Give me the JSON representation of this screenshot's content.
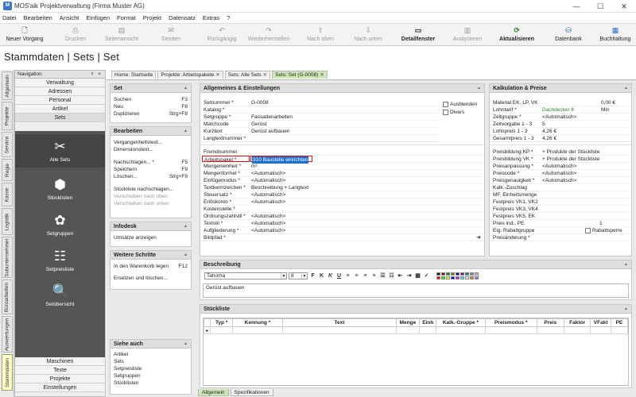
{
  "window": {
    "title": "MOS'aik Projektverwaltung (Firma Muster AG)",
    "minimize": "—",
    "maximize": "☐",
    "close": "✕"
  },
  "menu": [
    "Datei",
    "Bearbeiten",
    "Ansicht",
    "Einfügen",
    "Format",
    "Projekt",
    "Datensatz",
    "Extras",
    "?"
  ],
  "toolbar": {
    "neuer_vorgang": "Neuer Vorgang",
    "drucken": "Drucken",
    "seitenansicht": "Seitenansicht",
    "senden": "Senden",
    "rueckgaengig": "Rückgängig",
    "wiederherstellen": "Wiederherstellen",
    "nach_oben": "Nach oben",
    "nach_unten": "Nach unten",
    "detailfenster": "Detailfenster",
    "analysieren": "Analysieren",
    "aktualisieren": "Aktualisieren",
    "datenbank": "Datenbank",
    "buchhaltung": "Buchhaltung"
  },
  "page_title": "Stammdaten | Sets | Set",
  "vertical_tabs": [
    "Allgemein",
    "Projekte",
    "Service",
    "Regie",
    "Kasse",
    "Logistik",
    "Subunternehmer",
    "Büroarbeiten",
    "Auswertungen",
    "Stammdaten"
  ],
  "navigation": {
    "header": "Navigation",
    "pins": "ᵖ ×",
    "top_items": [
      "Verwaltung",
      "Adressen",
      "Personal",
      "Artikel",
      "Sets"
    ],
    "big_items": [
      "Alle Sets",
      "Stücklisten",
      "Setgruppen",
      "Setpreisliste",
      "Setübersicht"
    ],
    "bottom_items": [
      "Maschinen",
      "Texte",
      "Projekte",
      "Einstellungen"
    ]
  },
  "doc_tabs": [
    {
      "label": "Home: Startseite",
      "close": ""
    },
    {
      "label": "Projekte: Arbeitspakete",
      "close": "✕"
    },
    {
      "label": "Sets: Alle Sets",
      "close": "✕"
    },
    {
      "label": "Sets: Set (G-0008)",
      "close": "✕"
    }
  ],
  "set_panel": {
    "title": "Set",
    "items": [
      {
        "label": "Suchen",
        "key": "F3"
      },
      {
        "label": "Neu",
        "key": "F8"
      },
      {
        "label": "Duplizieren",
        "key": "Strg+F8"
      }
    ]
  },
  "bearbeiten_panel": {
    "title": "Bearbeiten",
    "items": [
      {
        "label": "Vergangenheitstext...",
        "key": "",
        "dis": false
      },
      {
        "label": "Dimensionstext...",
        "key": "",
        "dis": false
      },
      {
        "label": "",
        "key": "",
        "dis": false
      },
      {
        "label": "Nachschlagen... *",
        "key": "F5",
        "dis": false
      },
      {
        "label": "Speichern",
        "key": "F9",
        "dis": false
      },
      {
        "label": "Löschen...",
        "key": "Strg+F9",
        "dis": false
      },
      {
        "label": "",
        "key": "",
        "dis": false
      },
      {
        "label": "Stückliste nachschlagen...",
        "key": "",
        "dis": false
      },
      {
        "label": "Verschieben nach oben",
        "key": "",
        "dis": true
      },
      {
        "label": "Verschieben nach unten",
        "key": "",
        "dis": true
      }
    ]
  },
  "infodesk_panel": {
    "title": "Infodesk",
    "items": [
      "Umsätze anzeigen"
    ]
  },
  "weitere_panel": {
    "title": "Weitere Schritte",
    "items": [
      {
        "label": "In den Warenkorb legen",
        "key": "F12"
      },
      {
        "label": "Ersetzen und löschen...",
        "key": ""
      }
    ]
  },
  "siehe_panel": {
    "title": "Siehe auch",
    "items": [
      "Artikel",
      "Sets",
      "Setpreisliste",
      "Setgruppen",
      "Stücklisten"
    ]
  },
  "general": {
    "title": "Allgemeines & Einstellungen",
    "fields1": [
      {
        "label": "Setnummer *",
        "value": "G-0008"
      },
      {
        "label": "Katalog *",
        "value": ""
      },
      {
        "label": "Setgruppe *",
        "value": "Fassadenarbeiten"
      },
      {
        "label": "Matchcode",
        "value": "Gerüst"
      },
      {
        "label": "Kurztext",
        "value": "Gerüst aufbauen"
      },
      {
        "label": "Langtextnummer *",
        "value": ""
      }
    ],
    "checkboxes": [
      "Ausblenden",
      "Divers"
    ],
    "fields2": [
      {
        "label": "Fremdnummer",
        "value": ""
      },
      {
        "label": "Arbeitspaket *",
        "value": "310 Baustelle einrichten"
      },
      {
        "label": "Mengeneinheit *",
        "value": "m²"
      },
      {
        "label": "Mengenformel *",
        "value": "<Automatisch>"
      },
      {
        "label": "Einfügemodus *",
        "value": "<Automatisch>"
      },
      {
        "label": "Textkennzeichen *",
        "value": "Beschreibung + Langtext"
      },
      {
        "label": "Steuersatz *",
        "value": "<Automatisch>"
      },
      {
        "label": "Erlöskonto *",
        "value": "<Automatisch>"
      },
      {
        "label": "Kostenstelle *",
        "value": ""
      },
      {
        "label": "Ordnungszahlstil *",
        "value": "<Automatisch>"
      },
      {
        "label": "Textstil *",
        "value": "<Automatisch>"
      },
      {
        "label": "Aufgliederung *",
        "value": "<Automatisch>"
      },
      {
        "label": "Bildpfad *",
        "value": "",
        "arrow": "➜"
      }
    ]
  },
  "kalkulation": {
    "title": "Kalkulation & Preise",
    "fields1": [
      {
        "label": "Material EK, LP, VK",
        "value": "",
        "value2": "0,00 €"
      },
      {
        "label": "Lohntarif *",
        "value": "Dachdecker K",
        "value2": "Min",
        "green": true
      },
      {
        "label": "Zeitgruppe *",
        "value": "<Automatisch>",
        "value2": ""
      },
      {
        "label": "Zeitvorgabe 1 - 3",
        "value": "5",
        "value2": ""
      },
      {
        "label": "Lohnpreis 1 - 3",
        "value": "4,26 €",
        "value2": ""
      },
      {
        "label": "Gesamtpreis 1 - 3",
        "value": "4,26 €",
        "value2": ""
      }
    ],
    "fields2": [
      {
        "label": "Preisbildung KP *",
        "value": "+ Produkte der Stückliste",
        "value2": ""
      },
      {
        "label": "Preisbildung VK *",
        "value": "+ Produkte der Stückliste",
        "value2": ""
      },
      {
        "label": "Preisanpassung *",
        "value": "<Automatisch>",
        "value2": ""
      },
      {
        "label": "Preiscode *",
        "value": "<Automatisch>",
        "value2": ""
      },
      {
        "label": "Preisgenauigkeit *",
        "value": "<Automatisch>",
        "value2": ""
      },
      {
        "label": "Kalk.-Zuschlag",
        "value": "",
        "value2": ""
      },
      {
        "label": "MF, Einheitsmenge",
        "value": "",
        "value2": ""
      },
      {
        "label": "Festpreis VK1, VK2",
        "value": "",
        "value2": ""
      },
      {
        "label": "Festpreis VK3, VK4",
        "value": "",
        "value2": ""
      },
      {
        "label": "Festpreis VK5, EK",
        "value": "",
        "value2": ""
      },
      {
        "label": "Preis ind., PE",
        "value": "",
        "value2": "1"
      },
      {
        "label": "Eig. Rabattgruppe",
        "value": "",
        "value2": "Rabattsperre"
      },
      {
        "label": "Preisänderung *",
        "value": "",
        "value2": ""
      }
    ]
  },
  "beschreibung": {
    "title": "Beschreibung",
    "font": "Tahoma",
    "size": "8",
    "text": "Gerüst aufbauen"
  },
  "stueckliste": {
    "title": "Stückliste",
    "columns": [
      "Typ *",
      "Kennung *",
      "Text",
      "Menge",
      "Einh",
      "Kalk.-Gruppe *",
      "Preismodus *",
      "Preis",
      "Faktor",
      "VFakt",
      "PE"
    ]
  },
  "bottom_tabs": [
    "Allgemein",
    "Spezifikationen"
  ],
  "colors": {
    "active_tab": "#cde8b6",
    "nav_dark": "#555555",
    "highlight": "#1f6fd0",
    "red_box": "#d01818"
  }
}
